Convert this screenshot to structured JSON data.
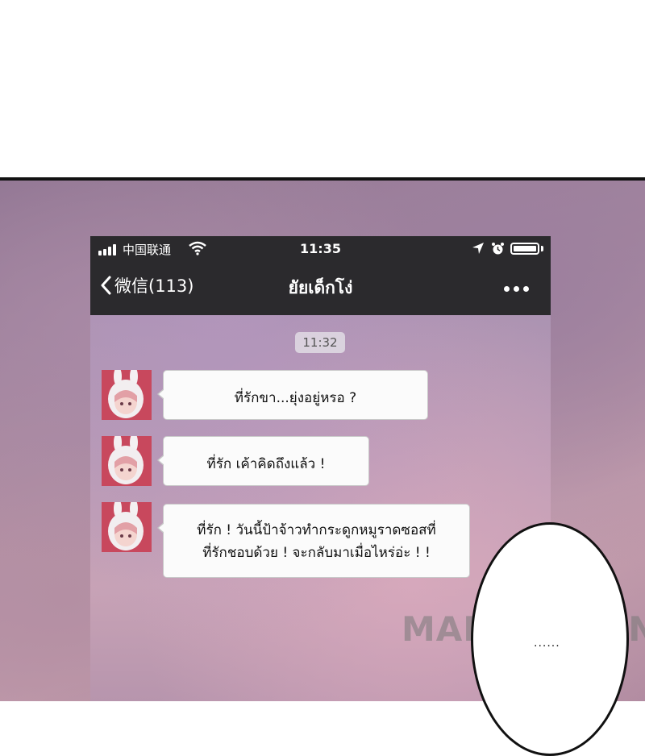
{
  "status_bar": {
    "carrier": "中国联通",
    "time": "11:35"
  },
  "nav": {
    "back_label": "微信(113)",
    "title": "ยัยเด็กโง่"
  },
  "chat": {
    "timestamp": "11:32",
    "messages": [
      {
        "text": "ที่รักขา...ยุ่งอยู่หรอ ?"
      },
      {
        "text": "ที่รัก เค้าคิดถึงแล้ว !"
      },
      {
        "text_line1": "ที่รัก ! วันนี้ป้าจ้าวทำกระดูกหมูราดซอสที่",
        "text_line2": "ที่รักชอบด้วย ! จะกลับมาเมื่อไหร่อ่ะ ! !"
      }
    ]
  },
  "speech_bubble": {
    "text": "......"
  },
  "watermark": "MANGATOON",
  "icons": [
    "signal-icon",
    "wifi-icon",
    "location-arrow-icon",
    "alarm-icon",
    "battery-icon",
    "back-chevron-icon",
    "more-dots-icon"
  ]
}
